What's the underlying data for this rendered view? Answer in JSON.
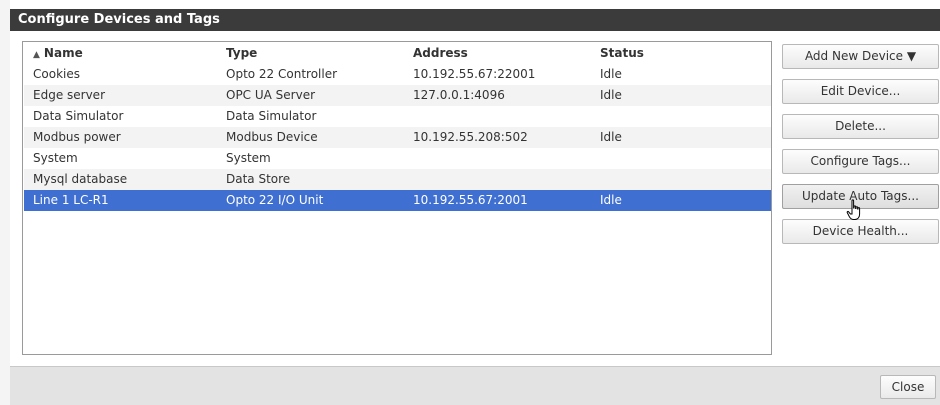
{
  "dialog": {
    "title": "Configure Devices and Tags",
    "close_label": "Close"
  },
  "table": {
    "columns": [
      "Name",
      "Type",
      "Address",
      "Status"
    ],
    "sort_indicator": "▲",
    "rows": [
      {
        "name": "Cookies",
        "type": "Opto 22 Controller",
        "address": "10.192.55.67:22001",
        "status": "Idle"
      },
      {
        "name": "Edge server",
        "type": "OPC UA Server",
        "address": "127.0.0.1:4096",
        "status": "Idle"
      },
      {
        "name": "Data Simulator",
        "type": "Data Simulator",
        "address": "",
        "status": ""
      },
      {
        "name": "Modbus power",
        "type": "Modbus Device",
        "address": "10.192.55.208:502",
        "status": "Idle"
      },
      {
        "name": "System",
        "type": "System",
        "address": "",
        "status": ""
      },
      {
        "name": "Mysql database",
        "type": "Data Store",
        "address": "",
        "status": ""
      },
      {
        "name": "Line 1 LC-R1",
        "type": "Opto 22 I/O Unit",
        "address": "10.192.55.67:2001",
        "status": "Idle"
      }
    ],
    "selected_row_index": 6
  },
  "actions": {
    "add_new_device": "Add New Device ▼",
    "edit_device": "Edit Device...",
    "delete": "Delete...",
    "configure_tags": "Configure Tags...",
    "update_auto_tags": "Update Auto Tags...",
    "device_health": "Device Health..."
  },
  "colors": {
    "title_bar": "#3b3b3b",
    "selection": "#3f6fd0",
    "footer": "#e3e3e3"
  },
  "icons": {
    "cursor": "hand-pointer-icon"
  }
}
